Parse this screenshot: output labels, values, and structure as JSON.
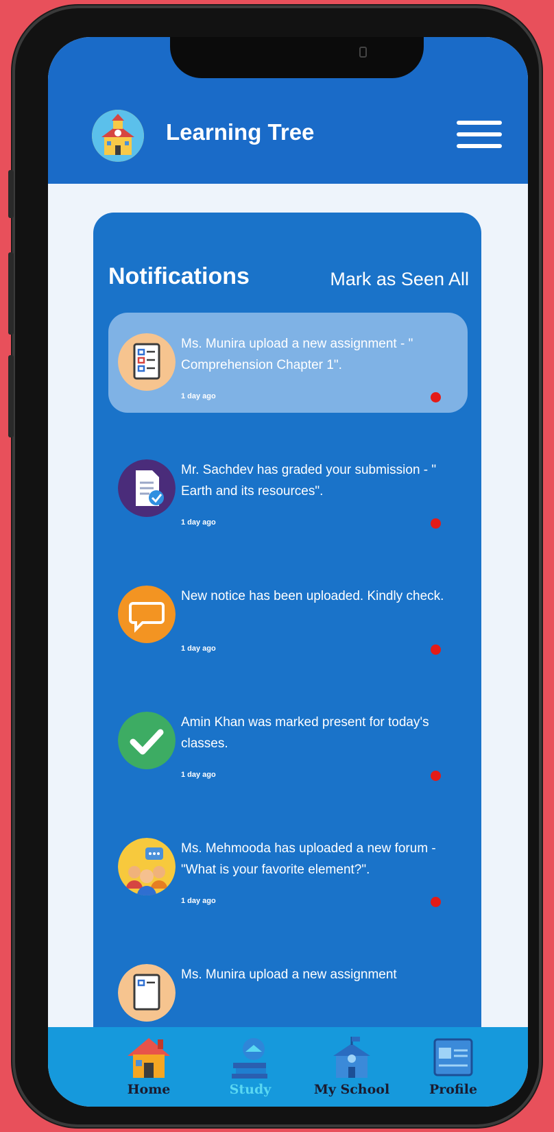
{
  "app": {
    "title": "Learning Tree"
  },
  "notifications": {
    "title": "Notifications",
    "mark_all_label": "Mark as Seen All",
    "items": [
      {
        "text": "Ms. Munira upload a new assignment - \" Comprehension Chapter 1\".",
        "time": "1 day ago",
        "icon": "assignment-icon",
        "unread": true,
        "highlighted": true
      },
      {
        "text": "Mr. Sachdev has graded your submission - \" Earth and its resources\".",
        "time": "1 day ago",
        "icon": "graded-document-icon",
        "unread": true,
        "highlighted": false
      },
      {
        "text": "New notice has been uploaded. Kindly check.",
        "time": "1 day ago",
        "icon": "chat-bubble-icon",
        "unread": true,
        "highlighted": false
      },
      {
        "text": "Amin Khan was marked present for today's classes.",
        "time": "1 day ago",
        "icon": "checkmark-icon",
        "unread": true,
        "highlighted": false
      },
      {
        "text": "Ms. Mehmooda has uploaded a new forum - \"What is your favorite element?\".",
        "time": "1 day ago",
        "icon": "forum-group-icon",
        "unread": true,
        "highlighted": false
      },
      {
        "text": "Ms. Munira upload a new assignment",
        "time": "",
        "icon": "assignment-icon",
        "unread": false,
        "highlighted": false
      }
    ]
  },
  "nav": {
    "items": [
      {
        "label": "Home",
        "icon": "house-icon",
        "active": false
      },
      {
        "label": "Study",
        "icon": "study-icon",
        "active": true
      },
      {
        "label": "My School",
        "icon": "school-building-icon",
        "active": false
      },
      {
        "label": "Profile",
        "icon": "id-card-icon",
        "active": false
      }
    ]
  },
  "colors": {
    "background": "#e8505b",
    "header": "#1a6bc8",
    "card": "#1a73c9",
    "highlight": "#7fb2e5",
    "unread_dot": "#e41b17",
    "nav_bar": "#1699dc",
    "nav_active": "#5ad8f2"
  }
}
